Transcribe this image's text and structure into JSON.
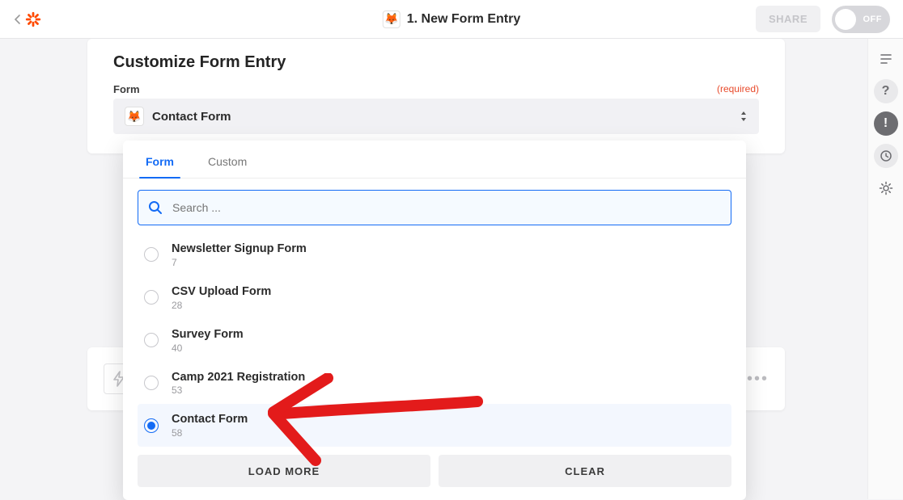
{
  "topbar": {
    "title": "1. New Form Entry",
    "share_label": "SHARE",
    "toggle_label": "OFF"
  },
  "main": {
    "section_title": "Customize Form Entry",
    "field_label": "Form",
    "required_label": "(required)",
    "selected_value": "Contact Form",
    "app_icon_emoji": "🦊"
  },
  "dropdown": {
    "tabs": [
      {
        "label": "Form",
        "active": true
      },
      {
        "label": "Custom",
        "active": false
      }
    ],
    "search_placeholder": "Search ...",
    "options": [
      {
        "label": "Newsletter Signup Form",
        "id": "7",
        "selected": false
      },
      {
        "label": "CSV Upload Form",
        "id": "28",
        "selected": false
      },
      {
        "label": "Survey Form",
        "id": "40",
        "selected": false
      },
      {
        "label": "Camp 2021 Registration",
        "id": "53",
        "selected": false
      },
      {
        "label": "Contact Form",
        "id": "58",
        "selected": true
      }
    ],
    "load_more_label": "LOAD MORE",
    "clear_label": "CLEAR"
  },
  "rail": {
    "items": [
      "notes-icon",
      "help-icon",
      "alert-icon",
      "history-icon",
      "settings-icon"
    ]
  }
}
